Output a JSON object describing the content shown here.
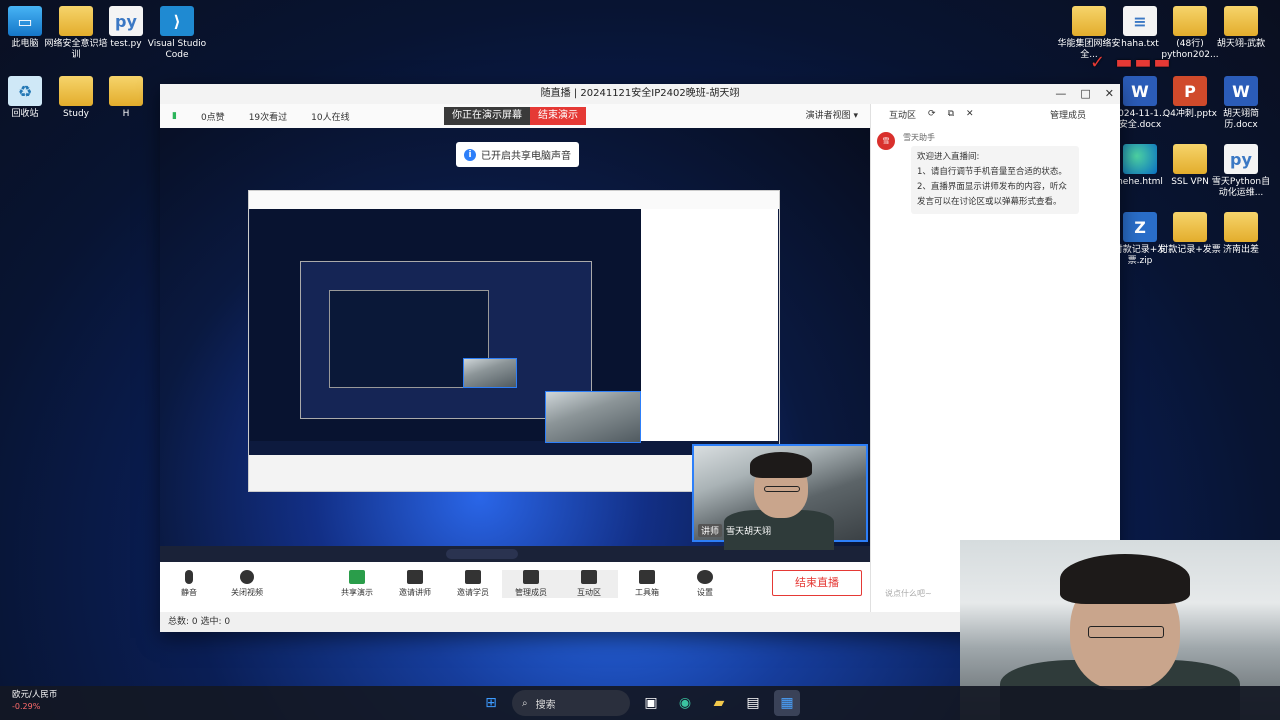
{
  "desktop_left": [
    {
      "label": "此电脑",
      "icon": "pc-icon"
    },
    {
      "label": "网络安全意识培训",
      "icon": "folder-icon"
    },
    {
      "label": "test.py",
      "icon": "python-file-icon"
    },
    {
      "label": "Visual Studio Code",
      "icon": "vscode-icon"
    },
    {
      "label": "回收站",
      "icon": "recycle-bin-icon"
    },
    {
      "label": "Study",
      "icon": "folder-icon"
    },
    {
      "label": "H",
      "icon": "folder-icon"
    }
  ],
  "desktop_right": [
    {
      "label": "华能集团网络安全...",
      "icon": "folder-icon"
    },
    {
      "label": "haha.txt",
      "icon": "text-file-icon"
    },
    {
      "label": "(48行) python202...",
      "icon": "folder-icon"
    },
    {
      "label": "胡天翊-武款",
      "icon": "folder-icon"
    },
    {
      "label": "2024-11-1... 安全.docx",
      "icon": "word-icon"
    },
    {
      "label": "Q4冲刺.pptx",
      "icon": "ppt-icon"
    },
    {
      "label": "胡天翊简历.docx",
      "icon": "word-icon"
    },
    {
      "label": "hehe.html",
      "icon": "edge-icon"
    },
    {
      "label": "SSL VPN",
      "icon": "folder-icon"
    },
    {
      "label": "雪天Python自动化运维...",
      "icon": "python-folder-icon"
    },
    {
      "label": "付款记录+发票.zip",
      "icon": "zip-icon"
    },
    {
      "label": "付款记录+发票",
      "icon": "folder-icon"
    },
    {
      "label": "济南出差",
      "icon": "folder-icon"
    }
  ],
  "live_window": {
    "title": "随直播 | 20241121安全IP2402晚班-胡天翊",
    "likes": "0点赞",
    "views": "19次看过",
    "online": "10人在线",
    "sharing_label": "你正在演示屏幕",
    "end_demo": "结束演示",
    "presenter_view": "演讲者视图",
    "toast": "已开启共享电脑声音",
    "presenter_name": "雪天胡天翊",
    "presenter_role": "讲师",
    "toolbar": [
      {
        "label": "静音",
        "icon": "microphone-icon"
      },
      {
        "label": "关闭视频",
        "icon": "camera-icon"
      },
      {
        "label": "共享演示",
        "icon": "share-screen-icon"
      },
      {
        "label": "邀请讲师",
        "icon": "invite-speaker-icon"
      },
      {
        "label": "邀请学员",
        "icon": "invite-student-icon"
      },
      {
        "label": "管理成员",
        "icon": "members-icon"
      },
      {
        "label": "互动区",
        "icon": "chat-icon"
      },
      {
        "label": "工具箱",
        "icon": "toolbox-icon"
      },
      {
        "label": "设置",
        "icon": "settings-icon"
      }
    ],
    "end_live": "结束直播",
    "status": "总数: 0  选中: 0"
  },
  "chat": {
    "tab_interact": "互动区",
    "tab_members": "管理成员",
    "sender": "雪天助手",
    "message": "欢迎进入直播间:\n1、请自行调节手机音量至合适的状态。\n2、直播界面显示讲师发布的内容，听众发言可以在讨论区或以弹幕形式查看。",
    "input_placeholder": "说点什么吧~"
  },
  "taskbar": {
    "widget_title": "欧元/人民币",
    "widget_value": "-0.29%",
    "search": "搜索"
  }
}
